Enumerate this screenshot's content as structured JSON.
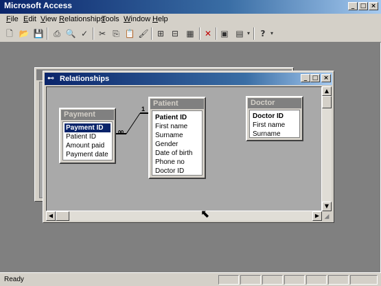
{
  "app": {
    "title": "Microsoft Access",
    "controls": {
      "minimize": "_",
      "maximize": "□",
      "close": "×"
    }
  },
  "menu": {
    "items": [
      {
        "label": "File",
        "key": "F",
        "rest": "ile"
      },
      {
        "label": "Edit",
        "key": "E",
        "rest": "dit"
      },
      {
        "label": "View",
        "key": "V",
        "rest": "iew"
      },
      {
        "label": "Relationships",
        "key": "R",
        "rest": "elationships"
      },
      {
        "label": "Tools",
        "key": "T",
        "rest": "ools"
      },
      {
        "label": "Window",
        "key": "W",
        "rest": "indow"
      },
      {
        "label": "Help",
        "key": "H",
        "rest": "elp"
      }
    ]
  },
  "toolbar": {
    "icons": [
      {
        "name": "new-icon",
        "glyph": "🗋"
      },
      {
        "name": "open-icon",
        "glyph": "📂"
      },
      {
        "name": "save-icon",
        "glyph": "💾"
      },
      {
        "name": "print-icon",
        "glyph": "⎙"
      },
      {
        "name": "print-preview-icon",
        "glyph": "🔍"
      },
      {
        "name": "spelling-icon",
        "glyph": "✓"
      },
      {
        "name": "cut-icon",
        "glyph": "✂"
      },
      {
        "name": "copy-icon",
        "glyph": "⎘"
      },
      {
        "name": "paste-icon",
        "glyph": "📋"
      },
      {
        "name": "format-painter-icon",
        "glyph": "🖌"
      },
      {
        "name": "show-table-icon",
        "glyph": "⊞"
      },
      {
        "name": "show-direct-icon",
        "glyph": "⊟"
      },
      {
        "name": "show-all-icon",
        "glyph": "▦"
      },
      {
        "name": "delete-icon",
        "glyph": "✕"
      },
      {
        "name": "database-window-icon",
        "glyph": "▣"
      },
      {
        "name": "new-object-icon",
        "glyph": "▤"
      },
      {
        "name": "help-icon",
        "glyph": "?"
      }
    ]
  },
  "relationships_window": {
    "title": "Relationships",
    "controls": {
      "minimize": "_",
      "maximize": "□",
      "close": "×"
    },
    "tables": [
      {
        "title": "Payment",
        "fields": [
          {
            "label": "Payment ID",
            "style": "selected"
          },
          {
            "label": "Patient ID",
            "style": "normal"
          },
          {
            "label": "Amount paid",
            "style": "normal"
          },
          {
            "label": "Payment date",
            "style": "normal"
          }
        ]
      },
      {
        "title": "Patient",
        "fields": [
          {
            "label": "Patient ID",
            "style": "key"
          },
          {
            "label": "First name",
            "style": "normal"
          },
          {
            "label": "Surname",
            "style": "normal"
          },
          {
            "label": "Gender",
            "style": "normal"
          },
          {
            "label": "Date of birth",
            "style": "normal"
          },
          {
            "label": "Phone no",
            "style": "normal"
          },
          {
            "label": "Doctor ID",
            "style": "normal"
          }
        ]
      },
      {
        "title": "Doctor",
        "fields": [
          {
            "label": "Doctor ID",
            "style": "key"
          },
          {
            "label": "First name",
            "style": "normal"
          },
          {
            "label": "Surname",
            "style": "normal"
          }
        ]
      }
    ],
    "relationship": {
      "one_label": "1",
      "many_label": "∞"
    }
  },
  "status": {
    "text": "Ready"
  }
}
